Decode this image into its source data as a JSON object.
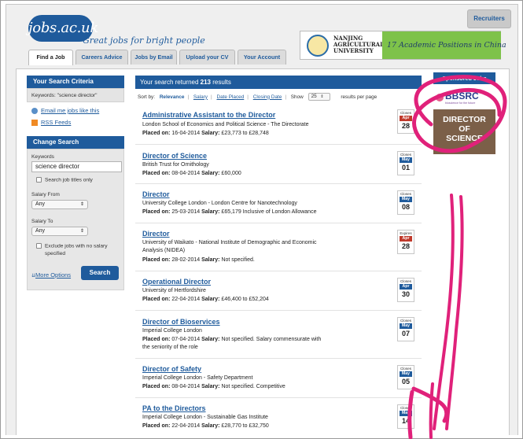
{
  "header": {
    "logo_text": "jobs.ac.uk",
    "tagline": "Great jobs for bright people",
    "recruiters_label": "Recruiters",
    "banner": {
      "university": [
        "NANJING",
        "AGRICULTURAL",
        "UNIVERSITY"
      ],
      "cta": "17 Academic Positions in China"
    },
    "tabs": [
      "Find a Job",
      "Careers Advice",
      "Jobs by Email",
      "Upload your CV",
      "Your Account"
    ]
  },
  "left": {
    "criteria_title": "Your Search Criteria",
    "keywords_line": "Keywords: \"science director\"",
    "email_link": "Email me jobs like this",
    "rss_link": "RSS Feeds",
    "change_title": "Change Search",
    "keywords_label": "Keywords",
    "keywords_value": "science director",
    "job_titles_only": "Search job titles only",
    "salary_from_label": "Salary From",
    "salary_from_value": "Any",
    "salary_to_label": "Salary To",
    "salary_to_value": "Any",
    "exclude_label_1": "Exclude jobs with no salary",
    "exclude_label_2": "specified",
    "more_options": "More Options",
    "search_button": "Search"
  },
  "results": {
    "header_prefix": "Your search returned",
    "header_count": "213",
    "header_suffix": "results",
    "sort_label": "Sort by:",
    "sort_options": [
      "Relevance",
      "Salary",
      "Date Placed",
      "Closing Date"
    ],
    "show_label": "Show",
    "per_page": "25",
    "per_page_suffix": "results per page",
    "placed_label": "Placed on:",
    "salary_label": "Salary:",
    "jobs": [
      {
        "title": "Administrative Assistant to the Director",
        "employer": "London School of Economics and Political Science - The Directorate",
        "placed": "16-04-2014",
        "salary": "£23,773 to £28,748",
        "cal_label": "Closes",
        "cal_month": "Apr",
        "cal_day": "28",
        "month_color": "#c0392b"
      },
      {
        "title": "Director of Science",
        "employer": "British Trust for Ornithology",
        "placed": "08-04-2014",
        "salary": "£60,000",
        "cal_label": "Closes",
        "cal_month": "May",
        "cal_day": "01",
        "month_color": "#1f5b9c"
      },
      {
        "title": "Director",
        "employer": "University College London - London Centre for Nanotechnology",
        "placed": "25-03-2014",
        "salary": "£65,179 Inclusive of London Allowance",
        "cal_label": "Closes",
        "cal_month": "May",
        "cal_day": "08",
        "month_color": "#1f5b9c"
      },
      {
        "title": "Director",
        "employer": "University of Waikato - National Institute of Demographic and Economic",
        "employer2": "Analysis (NIDEA)",
        "placed": "28-02-2014",
        "salary": "Not specified.",
        "cal_label": "Expires",
        "cal_month": "Apr",
        "cal_day": "28",
        "month_color": "#c0392b"
      },
      {
        "title": "Operational Director",
        "employer": "University of Hertfordshire",
        "placed": "22-04-2014",
        "salary": "£46,400 to £52,204",
        "cal_label": "Closes",
        "cal_month": "Apr",
        "cal_day": "30",
        "month_color": "#1f5b9c"
      },
      {
        "title": "Director of Bioservices",
        "employer": "Imperial College London",
        "placed": "07-04-2014",
        "salary": "Not specified. Salary commensurate with",
        "salary2": "the seniority of the role",
        "cal_label": "Closes",
        "cal_month": "May",
        "cal_day": "07",
        "month_color": "#1f5b9c"
      },
      {
        "title": "Director of Safety",
        "employer": "Imperial College London - Safety Department",
        "placed": "08-04-2014",
        "salary": "Not specified. Competitive",
        "cal_label": "Closes",
        "cal_month": "May",
        "cal_day": "05",
        "month_color": "#1f5b9c"
      },
      {
        "title": "PA to the Directors",
        "employer": "Imperial College London - Sustainable Gas Institute",
        "placed": "22-04-2014",
        "salary": "£28,770 to £32,750",
        "cal_label": "Closes",
        "cal_month": "May",
        "cal_day": "14",
        "month_color": "#1f5b9c"
      }
    ]
  },
  "sponsored": {
    "title": "Sponsored Jobs",
    "brand": "BBSRC",
    "brand_sub": "bioscience for the future",
    "ad_text": [
      "DIRECTOR",
      "OF",
      "SCIENCE"
    ]
  },
  "colors": {
    "brand_blue": "#1f5b9c",
    "closing_red": "#c0392b",
    "annotation_pink": "#e0217a"
  }
}
